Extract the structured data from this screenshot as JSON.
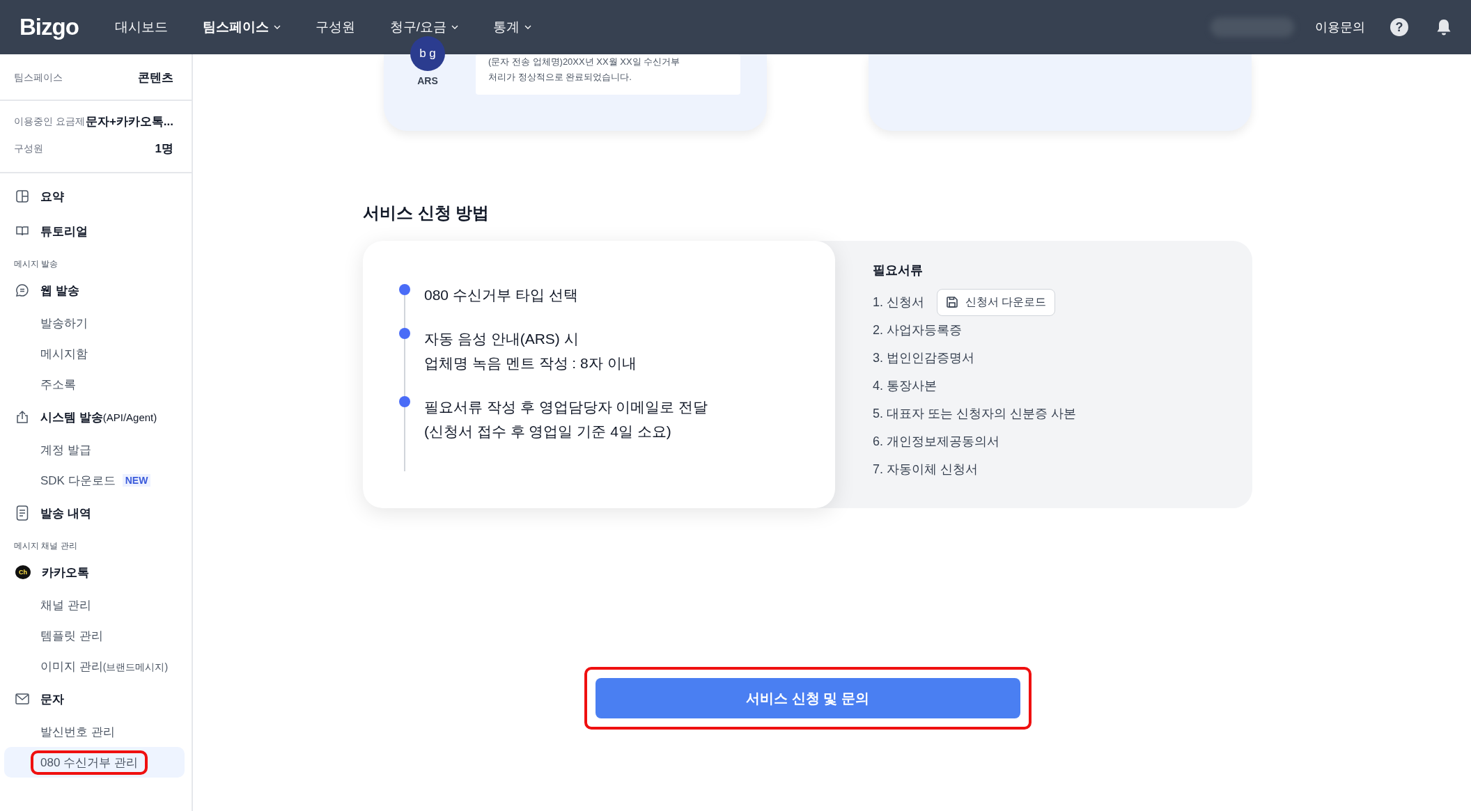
{
  "topbar": {
    "logo": "Bizgo",
    "nav": [
      {
        "label": "대시보드",
        "selected": false,
        "dropdown": false
      },
      {
        "label": "팀스페이스",
        "selected": true,
        "dropdown": true
      },
      {
        "label": "구성원",
        "selected": false,
        "dropdown": false
      },
      {
        "label": "청구/요금",
        "selected": false,
        "dropdown": true
      },
      {
        "label": "통계",
        "selected": false,
        "dropdown": true
      }
    ],
    "contact": "이용문의",
    "help": "?"
  },
  "sidebar": {
    "info": [
      {
        "label": "팀스페이스",
        "value": "콘텐츠"
      },
      {
        "label": "이용중인 요금제",
        "value": "문자+카카오톡..."
      },
      {
        "label": "구성원",
        "value": "1명"
      }
    ],
    "menu": [
      {
        "kind": "main",
        "label": "요약",
        "selected": false
      },
      {
        "kind": "main",
        "label": "튜토리얼",
        "selected": false
      },
      {
        "kind": "header",
        "label": "메시지 발송"
      },
      {
        "kind": "main",
        "label": "웹 발송",
        "selected": false
      },
      {
        "kind": "sub",
        "label": "발송하기",
        "selected": false,
        "highlighted": false
      },
      {
        "kind": "sub",
        "label": "메시지함",
        "selected": false,
        "highlighted": false
      },
      {
        "kind": "sub",
        "label": "주소록",
        "selected": false,
        "highlighted": false
      },
      {
        "kind": "main",
        "label": "시스템 발송",
        "note": "(API/Agent)",
        "selected": false
      },
      {
        "kind": "sub",
        "label": "계정 발급",
        "selected": false,
        "highlighted": false
      },
      {
        "kind": "sub",
        "label": "SDK 다운로드",
        "badge": "NEW",
        "selected": false,
        "highlighted": false
      },
      {
        "kind": "main",
        "label": "발송 내역",
        "selected": false
      },
      {
        "kind": "header",
        "label": "메시지 채널 관리"
      },
      {
        "kind": "main",
        "icon_text": "Ch",
        "label": "카카오톡",
        "selected": false
      },
      {
        "kind": "sub",
        "label": "채널 관리",
        "selected": false,
        "highlighted": false
      },
      {
        "kind": "sub",
        "label": "템플릿 관리",
        "selected": false,
        "highlighted": false
      },
      {
        "kind": "sub",
        "label": "이미지 관리",
        "note": "(브랜드메시지)",
        "selected": false,
        "highlighted": false
      },
      {
        "kind": "main",
        "label": "문자",
        "selected": false
      },
      {
        "kind": "sub",
        "label": "발신번호 관리",
        "selected": false,
        "highlighted": false
      },
      {
        "kind": "sub",
        "label": "080 수신거부 관리",
        "selected": true,
        "highlighted": true
      }
    ]
  },
  "preview": {
    "avatar_text": "b g",
    "avatar_label": "ARS",
    "message_lines": [
      "(문자 전송 업체명)20XX년 XX월 XX일 수신거부",
      "처리가 정상적으로 완료되었습니다."
    ]
  },
  "section": {
    "title": "서비스 신청 방법",
    "steps": [
      {
        "lines": [
          "080 수신거부 타입 선택"
        ]
      },
      {
        "lines": [
          "자동 음성 안내(ARS) 시",
          "업체명 녹음 멘트 작성 : 8자 이내"
        ]
      },
      {
        "lines": [
          "필요서류 작성 후 영업담당자 이메일로 전달",
          "(신청서 접수 후 영업일 기준 4일 소요)"
        ]
      }
    ],
    "documents_title": "필요서류",
    "documents": [
      {
        "label": "1. 신청서",
        "download": "신청서 다운로드"
      },
      {
        "label": "2. 사업자등록증"
      },
      {
        "label": "3. 법인인감증명서"
      },
      {
        "label": "4. 통장사본"
      },
      {
        "label": "5. 대표자 또는 신청자의 신분증 사본"
      },
      {
        "label": "6. 개인정보제공동의서"
      },
      {
        "label": "7. 자동이체 신청서"
      }
    ]
  },
  "cta": {
    "label": "서비스 신청 및 문의",
    "highlighted": true
  }
}
